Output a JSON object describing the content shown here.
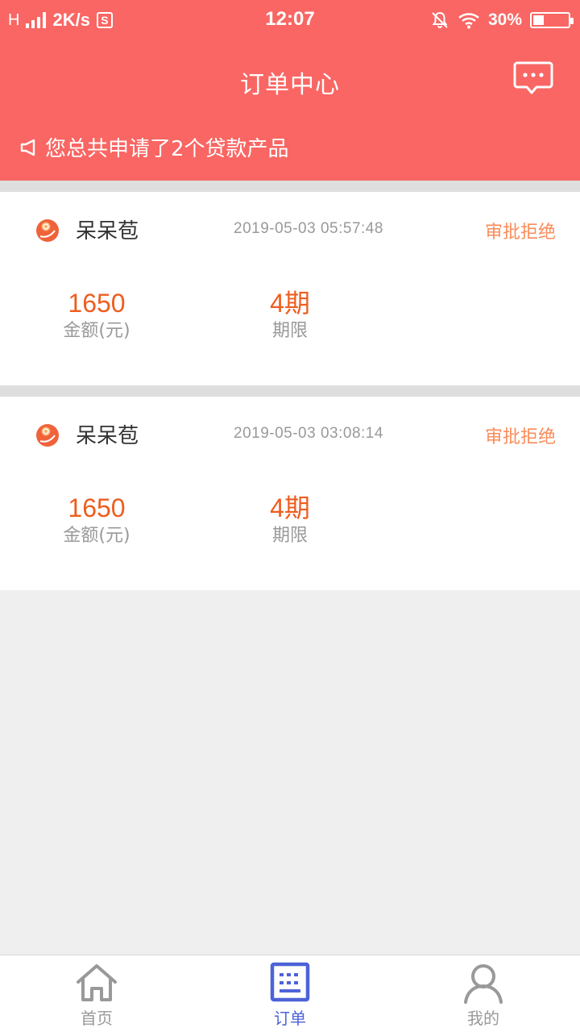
{
  "status_bar": {
    "network_type": "H",
    "speed": "2K/s",
    "s_badge": "S",
    "time": "12:07",
    "battery": "30%",
    "battery_level": 0.3,
    "icons": [
      "signal-icon",
      "sim-s-icon",
      "mute-bell-icon",
      "wifi-icon",
      "battery-icon"
    ]
  },
  "header": {
    "title": "订单中心",
    "notice": "您总共申请了2个贷款产品",
    "icons": [
      "message-icon",
      "megaphone-icon"
    ]
  },
  "orders": [
    {
      "brand": "呆呆苞",
      "time": "2019-05-03 05:57:48",
      "status": "审批拒绝",
      "amount": "1650",
      "amount_label": "金额(元)",
      "term": "4期",
      "term_label": "期限"
    },
    {
      "brand": "呆呆苞",
      "time": "2019-05-03 03:08:14",
      "status": "审批拒绝",
      "amount": "1650",
      "amount_label": "金额(元)",
      "term": "4期",
      "term_label": "期限"
    }
  ],
  "bottom_nav": {
    "items": [
      {
        "label": "首页",
        "icon": "home-icon",
        "active": false
      },
      {
        "label": "订单",
        "icon": "orders-icon",
        "active": true
      },
      {
        "label": "我的",
        "icon": "profile-icon",
        "active": false
      }
    ]
  },
  "colors": {
    "primary": "#f96663",
    "accent_orange": "#ee5d1f",
    "status_text": "#f98c5a",
    "nav_active": "#4d63d8"
  }
}
